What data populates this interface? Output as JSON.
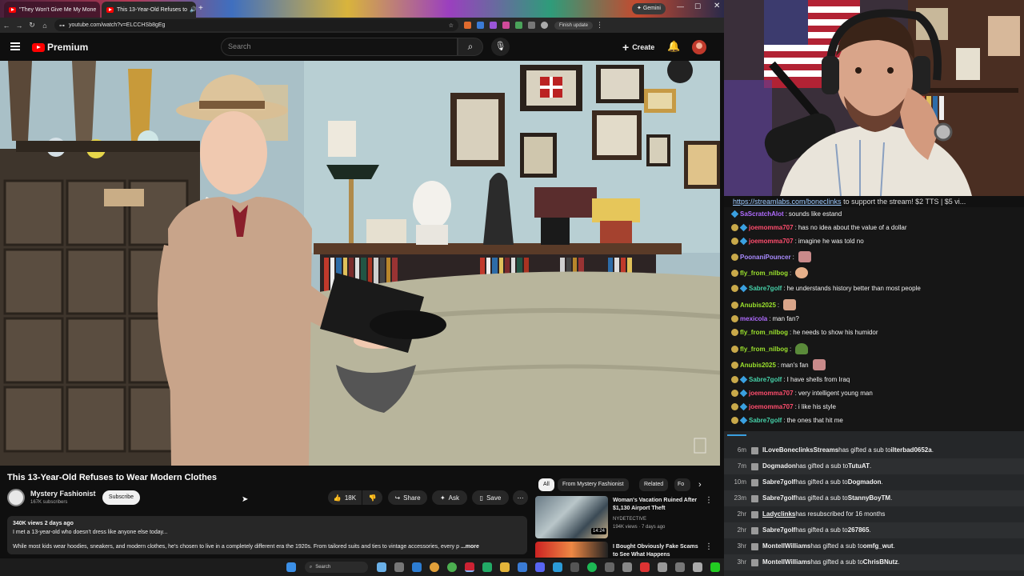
{
  "browser": {
    "tabs": [
      {
        "title": "\"They Won't Give Me My Mone"
      },
      {
        "title": "This 13-Year-Old Refuses to"
      }
    ],
    "gemini": "Gemini",
    "url": "youtube.com/watch?v=ELCCHSb8gEg",
    "finish_update": "Finish update"
  },
  "youtube": {
    "logo": "Premium",
    "search_placeholder": "Search",
    "create": "Create",
    "video_title": "This 13-Year-Old Refuses to Wear Modern Clothes",
    "channel": "Mystery Fashionist",
    "subscribers": "167K subscribers",
    "subscribe": "Subscribe",
    "likes": "18K",
    "share": "Share",
    "ask": "Ask",
    "save": "Save",
    "views_date": "340K views  2 days ago",
    "desc_line1": "I met a 13-year-old who doesn't dress like anyone else today...",
    "desc_line2": "While most kids wear hoodies, sneakers, and modern clothes, he's chosen to live in a completely different era the 1920s. From tailored suits and ties to vintage accessories, every p",
    "more": "...more",
    "chips": [
      "All",
      "From Mystery Fashionist",
      "Related",
      "Fo"
    ],
    "rec1": {
      "title": "Woman's Vacation Ruined After $1,130 Airport Theft",
      "channel": "NYDETECTIVE",
      "meta": "194K views · 7 days ago",
      "duration": "14:24"
    },
    "rec2": {
      "title": "I Bought Obviously Fake Scams to See What Happens"
    }
  },
  "taskbar": {
    "search": "Search"
  },
  "stream": {
    "promo_link": "https://streamlabs.com/boneclinks",
    "promo_rest": " to support the stream! $2 TTS | $5 vi..."
  },
  "chat": [
    {
      "user": "SaScratchAlot",
      "color": "#b06cff",
      "text": "sounds like estand"
    },
    {
      "user": "joemomma707",
      "color": "#ff4d6d",
      "text": "has no idea about the value of a dollar"
    },
    {
      "user": "joemomma707",
      "color": "#ff4d6d",
      "text": "imagine he was told no"
    },
    {
      "user": "PoonaniPouncer",
      "color": "#a98bff",
      "text": ""
    },
    {
      "user": "fly_from_nilbog",
      "color": "#9be22d",
      "text": ""
    },
    {
      "user": "Sabre7golf",
      "color": "#46d0a8",
      "text": "he understands history better than most people"
    },
    {
      "user": "Anubis2025",
      "color": "#9be22d",
      "text": ""
    },
    {
      "user": "mexicola",
      "color": "#b06cff",
      "text": "man fan?"
    },
    {
      "user": "fly_from_nilbog",
      "color": "#9be22d",
      "text": "he needs to show his humidor"
    },
    {
      "user": "fly_from_nilbog",
      "color": "#9be22d",
      "text": ""
    },
    {
      "user": "Anubis2025",
      "color": "#9be22d",
      "text": "man's fan"
    },
    {
      "user": "Sabre7golf",
      "color": "#46d0a8",
      "text": "I have shells from Iraq"
    },
    {
      "user": "joemomma707",
      "color": "#ff4d6d",
      "text": "very intelligent young man"
    },
    {
      "user": "joemomma707",
      "color": "#ff4d6d",
      "text": "i like his style"
    },
    {
      "user": "Sabre7golf",
      "color": "#46d0a8",
      "text": "the ones that hit me"
    }
  ],
  "events": [
    {
      "time": "6m",
      "user": "ILoveBoneclinksStreams",
      "text": " has gifted a sub to ",
      "target": "ilterbad0652a",
      "end": "."
    },
    {
      "time": "7m",
      "user": "Dogmadon",
      "text": " has gifted a sub to ",
      "target": "TutuAT",
      "end": "."
    },
    {
      "time": "10m",
      "user": "Sabre7golf",
      "text": " has gifted a sub to ",
      "target": "Dogmadon",
      "end": "."
    },
    {
      "time": "23m",
      "user": "Sabre7golf",
      "text": " has gifted a sub to ",
      "target": "StannyBoyTM",
      "end": "."
    },
    {
      "time": "2hr",
      "user": "Ladyclinks",
      "text": " has resubscribed for 16 months",
      "target": "",
      "end": ""
    },
    {
      "time": "2hr",
      "user": "Sabre7golf",
      "text": " has gifted a sub to ",
      "target": "267865",
      "end": "."
    },
    {
      "time": "3hr",
      "user": "MontellWilliams",
      "text": " has gifted a sub to ",
      "target": "omfg_wut",
      "end": "."
    },
    {
      "time": "3hr",
      "user": "MontellWilliams",
      "text": " has gifted a sub to ",
      "target": "ChrisBNutz",
      "end": "."
    }
  ]
}
